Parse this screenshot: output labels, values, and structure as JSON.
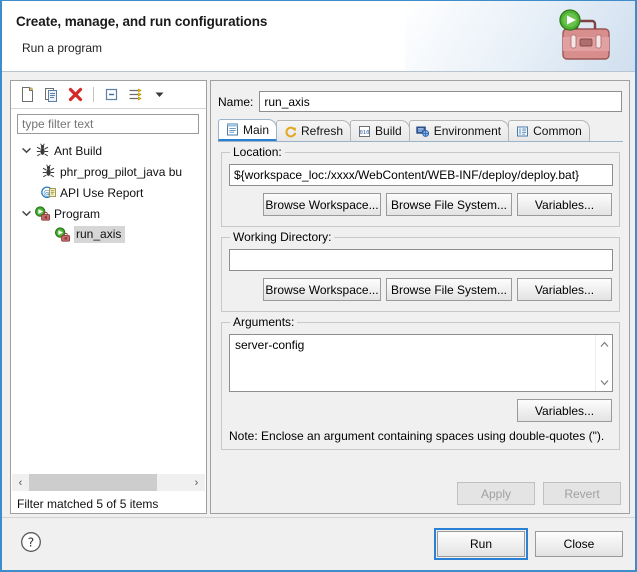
{
  "header": {
    "title": "Create, manage, and run configurations",
    "subtitle": "Run a program",
    "icon": "run-briefcase-icon"
  },
  "left_panel": {
    "toolbar": [
      {
        "name": "new-configuration-icon",
        "label": "New launch configuration"
      },
      {
        "name": "duplicate-configuration-icon",
        "label": "Duplicate"
      },
      {
        "name": "delete-configuration-icon",
        "label": "Delete"
      },
      {
        "name": "collapse-all-icon",
        "label": "Collapse All"
      },
      {
        "name": "filter-configurations-icon",
        "label": "Filter launch configurations"
      },
      {
        "name": "view-menu-chevron-icon",
        "label": "View Menu"
      }
    ],
    "filter": {
      "placeholder": "type filter text",
      "value": ""
    },
    "tree": [
      {
        "label": "Ant Build",
        "icon": "ant-icon",
        "indent": 1,
        "expanded": true,
        "selected": false
      },
      {
        "label": "phr_prog_pilot_java bu",
        "icon": "ant-icon",
        "indent": 2,
        "expanded": null,
        "selected": false
      },
      {
        "label": "API Use Report",
        "icon": "api-use-report-icon",
        "indent": 2,
        "expanded": null,
        "selected": false
      },
      {
        "label": "Program",
        "icon": "program-run-icon",
        "indent": 1,
        "expanded": true,
        "selected": false
      },
      {
        "label": "run_axis",
        "icon": "program-run-icon",
        "indent": 3,
        "expanded": null,
        "selected": true
      }
    ],
    "scrollbar": {
      "left_arrow": "‹",
      "right_arrow": "›"
    },
    "status": "Filter matched 5 of 5 items"
  },
  "right_panel": {
    "name_label": "Name:",
    "name_value": "run_axis",
    "tabs": [
      {
        "label": "Main",
        "icon": "main-tab-icon",
        "active": true
      },
      {
        "label": "Refresh",
        "icon": "refresh-tab-icon",
        "active": false
      },
      {
        "label": "Build",
        "icon": "build-tab-icon",
        "active": false
      },
      {
        "label": "Environment",
        "icon": "environment-tab-icon",
        "active": false
      },
      {
        "label": "Common",
        "icon": "common-tab-icon",
        "active": false
      }
    ],
    "location": {
      "title": "Location:",
      "value": "${workspace_loc:/xxxx/WebContent/WEB-INF/deploy/deploy.bat}",
      "buttons": [
        "Browse Workspace...",
        "Browse File System...",
        "Variables..."
      ]
    },
    "working_directory": {
      "title": "Working Directory:",
      "value": "",
      "buttons": [
        "Browse Workspace...",
        "Browse File System...",
        "Variables..."
      ]
    },
    "arguments": {
      "title": "Arguments:",
      "value": "server-config",
      "variables_button": "Variables...",
      "note": "Note: Enclose an argument containing spaces using double-quotes (\")."
    },
    "apply_label": "Apply",
    "revert_label": "Revert",
    "apply_enabled": false,
    "revert_enabled": false
  },
  "footer": {
    "help_icon": "help-question-icon",
    "run_label": "Run",
    "close_label": "Close",
    "run_focused": true
  },
  "colors": {
    "dialog_border": "#3f8ccb",
    "panel_bg": "#f0f0f0",
    "field_bg": "#ffffff",
    "selection": "#d6d6d6",
    "accent": "#2b7fd4",
    "delete_red": "#d42a2a",
    "run_green": "#3fa62a"
  }
}
